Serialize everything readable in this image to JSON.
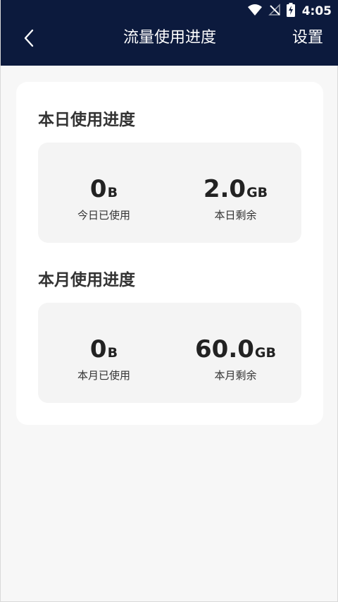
{
  "status_bar": {
    "time": "4:05",
    "icons": [
      "wifi-icon",
      "no-signal-icon",
      "battery-charging-icon"
    ]
  },
  "nav": {
    "back_icon": "chevron-left-icon",
    "title": "流量使用进度",
    "settings_label": "设置"
  },
  "daily": {
    "section_title": "本日使用进度",
    "used_value": "0",
    "used_unit": "B",
    "used_label": "今日已使用",
    "remaining_value": "2.0",
    "remaining_unit": "GB",
    "remaining_label": "本日剩余"
  },
  "monthly": {
    "section_title": "本月使用进度",
    "used_value": "0",
    "used_unit": "B",
    "used_label": "本月已使用",
    "remaining_value": "60.0",
    "remaining_unit": "GB",
    "remaining_label": "本月剩余"
  },
  "colors": {
    "header_bg": "#0c1a3d",
    "page_bg": "#f7f7f7",
    "card_bg": "#ffffff",
    "stat_box_bg": "#f4f4f4"
  }
}
